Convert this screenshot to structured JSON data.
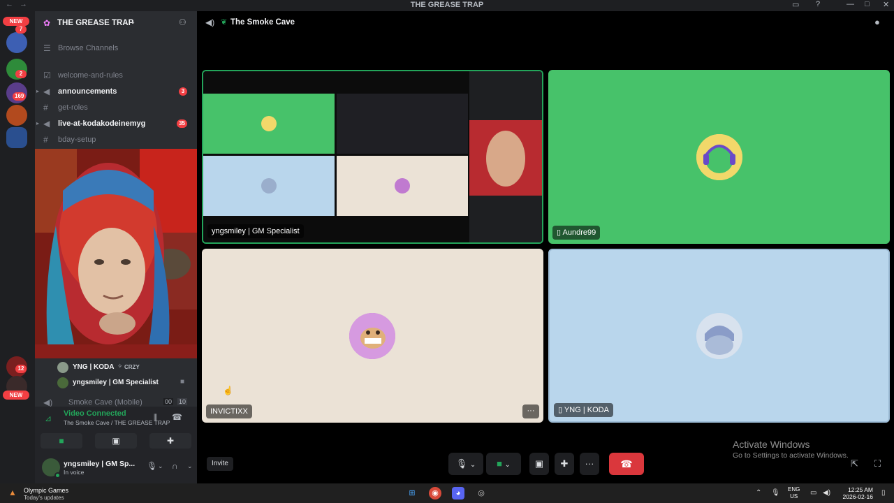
{
  "window": {
    "title": "THE GREASE TRAP"
  },
  "server_rail": {
    "new_top_label": "NEW",
    "new_bottom_label": "NEW",
    "badges": [
      "7",
      "2",
      "169",
      "12"
    ]
  },
  "guild": {
    "name": "THE GREASE TRAP"
  },
  "channels": {
    "browse_label": "Browse Channels",
    "items": [
      {
        "name": "welcome-and-rules",
        "badge": ""
      },
      {
        "name": "announcements",
        "badge": "3"
      },
      {
        "name": "get-roles",
        "badge": ""
      },
      {
        "name": "live-at-kodakodeinemyg",
        "badge": "35"
      },
      {
        "name": "bday-setup",
        "badge": ""
      }
    ]
  },
  "voice_members": {
    "users": [
      {
        "name": "YNG | KODA",
        "tag": "CRZY"
      },
      {
        "name": "yngsmiley | GM Specialist"
      }
    ],
    "other_channel": {
      "name": "Smoke Cave (Mobile)",
      "count_a": "00",
      "count_b": "10"
    }
  },
  "voice_panel": {
    "status": "Video Connected",
    "location": "The Smoke Cave / THE GREASE TRAP"
  },
  "user_panel": {
    "name": "yngsmiley | GM Sp...",
    "status": "In voice"
  },
  "call": {
    "room_name": "The Smoke Cave",
    "tiles": [
      {
        "label": "yngsmiley | GM Specialist",
        "bg": "#000000",
        "type": "screenshare"
      },
      {
        "label": "Aundre99",
        "bg": "#47c26a",
        "mobile": true
      },
      {
        "label": "INVICTIXX",
        "bg": "#ebe2d6"
      },
      {
        "label": "YNG | KODA",
        "bg": "#b9d6ec",
        "mobile": true
      }
    ],
    "invite_label": "Invite",
    "tile_menu": "···"
  },
  "watermark": {
    "line1": "Activate Windows",
    "line2": "Go to Settings to activate Windows."
  },
  "taskbar": {
    "news_title": "Olympic Games",
    "news_sub": "Today's updates",
    "lang_top": "ENG",
    "lang_bottom": "US",
    "time": "12:25 AM",
    "date": "2026-02-16"
  },
  "colors": {
    "accent_green": "#23a55a",
    "danger": "#da373c",
    "badge": "#f23f43"
  }
}
